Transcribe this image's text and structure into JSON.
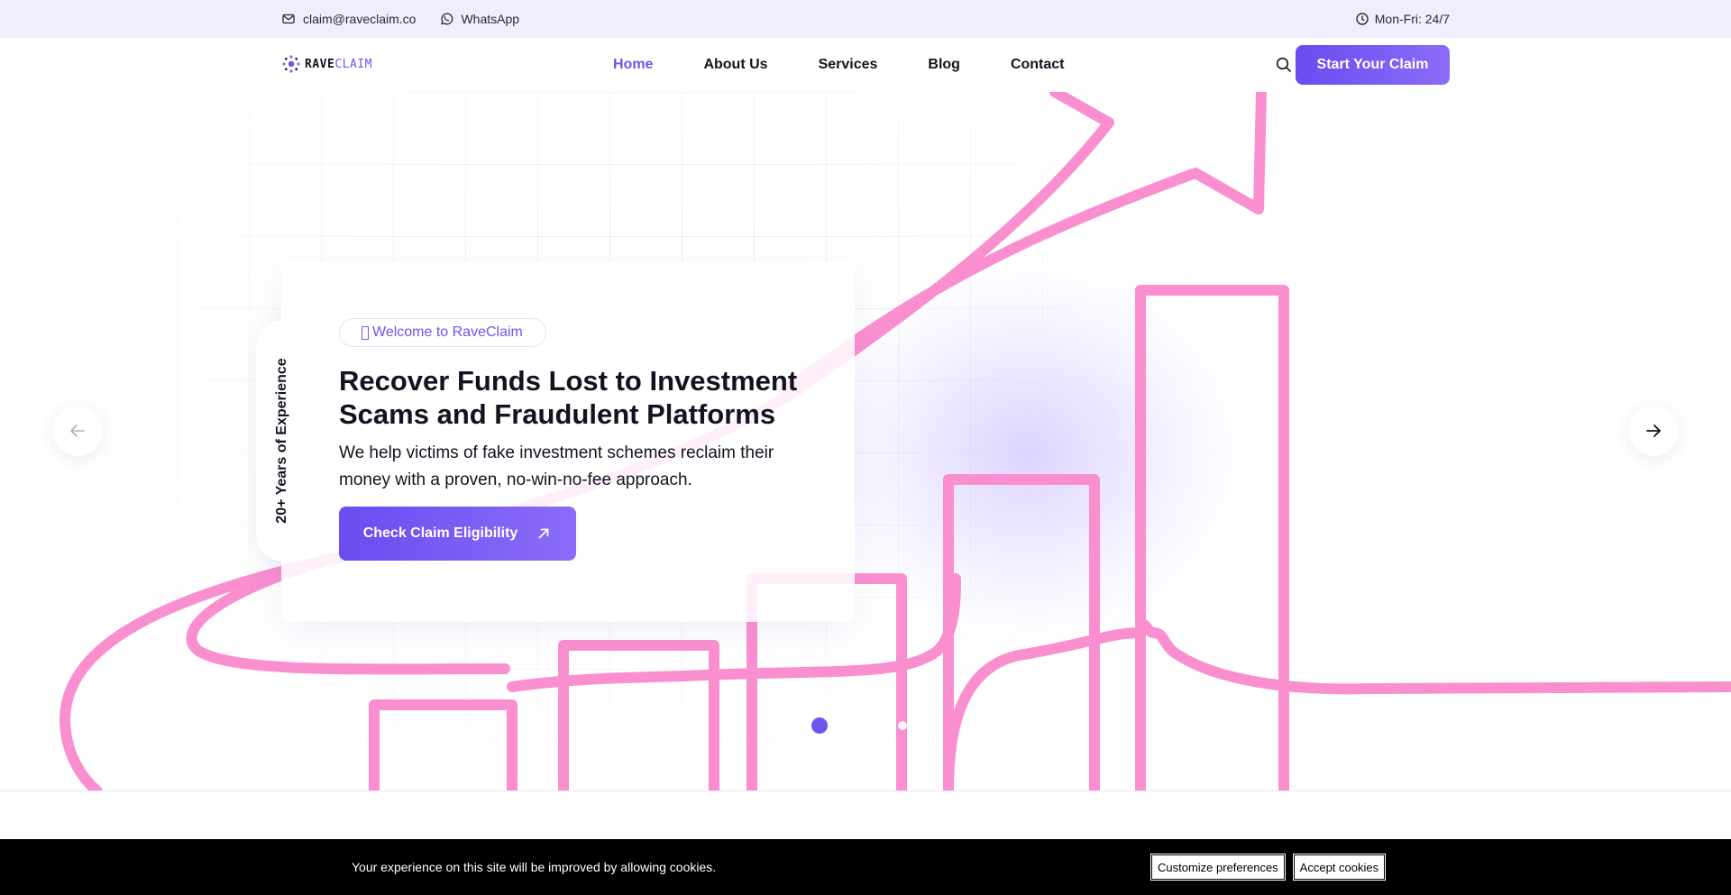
{
  "topbar": {
    "email": "claim@raveclaim.co",
    "whatsapp": "WhatsApp",
    "hours": "Mon-Fri: 24/7"
  },
  "brand": {
    "part1": "RAVE",
    "part2": "CLAIM"
  },
  "nav": {
    "items": [
      "Home",
      "About Us",
      "Services",
      "Blog",
      "Contact"
    ],
    "active": "Home"
  },
  "header": {
    "cta": "Start Your Claim"
  },
  "hero": {
    "badge": "Welcome to RaveClaim",
    "title": "Recover Funds Lost to Investment Scams and Fraudulent Platforms",
    "subtitle": "We help victims of fake investment schemes reclaim their money with a proven, no-win-no-fee approach.",
    "cta": "Check Claim Eligibility",
    "experience": "20+ Years of Experience",
    "slides": 3,
    "active_slide": 1
  },
  "cookie": {
    "message": "Your experience on this site will be improved by allowing cookies.",
    "customize": "Customize preferences",
    "accept": "Accept cookies"
  },
  "colors": {
    "accent": "#6d55f0",
    "topbar_bg": "#f1edfd",
    "art_line": "#fa8fd0",
    "cookie_bg": "#000000"
  },
  "icons": {
    "email": "mail-icon",
    "whatsapp": "whatsapp-icon",
    "hours": "clock-icon",
    "search": "search-icon",
    "prev": "arrow-left-icon",
    "next": "arrow-right-icon",
    "cta_arrow": "arrow-up-right-icon"
  }
}
